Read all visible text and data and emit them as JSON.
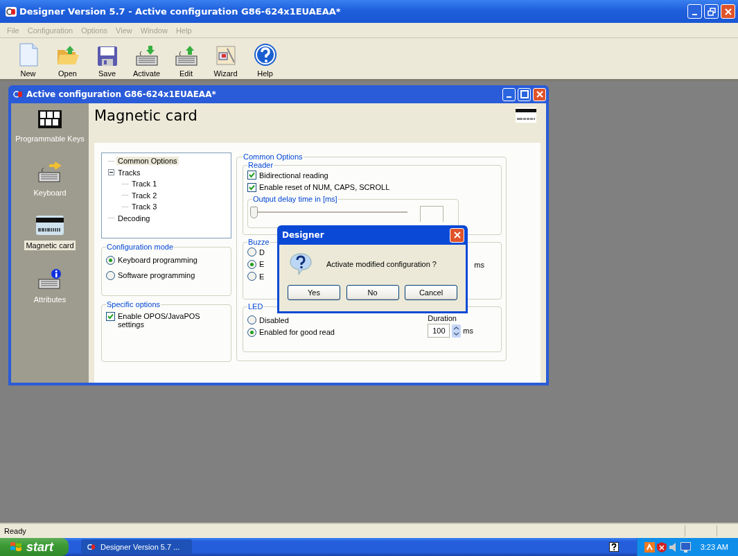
{
  "app_window": {
    "title": "Designer Version 5.7 - Active configuration G86-624x1EUAEAA*"
  },
  "menu": [
    {
      "label": "File",
      "disabled": true
    },
    {
      "label": "Configuration",
      "disabled": true
    },
    {
      "label": "Options",
      "disabled": true
    },
    {
      "label": "View",
      "disabled": true
    },
    {
      "label": "Window",
      "disabled": true
    },
    {
      "label": "Help",
      "disabled": true
    }
  ],
  "toolbar": [
    {
      "label": "New",
      "kind": "new"
    },
    {
      "label": "Open",
      "kind": "open"
    },
    {
      "label": "Save",
      "kind": "save"
    },
    {
      "label": "Activate",
      "kind": "activate"
    },
    {
      "label": "Edit",
      "kind": "edit"
    },
    {
      "label": "Wizard",
      "kind": "wizard"
    },
    {
      "label": "Help",
      "kind": "help"
    }
  ],
  "child_window": {
    "title": "Active configuration G86-624x1EUAEAA*"
  },
  "sidebar": [
    {
      "label": "Programmable Keys",
      "kind": "keys",
      "selected": false
    },
    {
      "label": "Keyboard",
      "kind": "keyboard",
      "selected": false
    },
    {
      "label": "Magnetic card",
      "kind": "card",
      "selected": true
    },
    {
      "label": "Attributes",
      "kind": "attributes",
      "selected": false
    }
  ],
  "page_title": "Magnetic card",
  "tree": [
    {
      "label": "Common Options",
      "selected": true
    },
    {
      "label": "Tracks",
      "selected": false,
      "expanded": true,
      "children": [
        {
          "label": "Track 1",
          "selected": false
        },
        {
          "label": "Track 2",
          "selected": false
        },
        {
          "label": "Track 3",
          "selected": false
        }
      ]
    },
    {
      "label": "Decoding",
      "selected": false
    }
  ],
  "configuration_mode": {
    "title": "Configuration mode",
    "options": [
      {
        "label": "Keyboard programming",
        "selected": true
      },
      {
        "label": "Software programming",
        "selected": false
      }
    ]
  },
  "specific_options": {
    "title": "Specific options",
    "options": [
      {
        "label": "Enable OPOS/JavaPOS settings",
        "checked": true
      }
    ]
  },
  "common_options": {
    "title": "Common Options",
    "reader": {
      "title": "Reader",
      "options": [
        {
          "label": "Bidirectional reading",
          "checked": true
        },
        {
          "label": "Enable reset of NUM, CAPS, SCROLL",
          "checked": true
        }
      ],
      "output_delay": {
        "title": "Output delay time in [ms]",
        "level": 0
      }
    },
    "buzzer": {
      "title": "Buzze",
      "options": [
        {
          "label": "D",
          "selected": false
        },
        {
          "label": "E",
          "selected": true
        },
        {
          "label": "E",
          "selected": false
        }
      ],
      "unit": "ms"
    },
    "led": {
      "title": "LED",
      "options": [
        {
          "label": "Disabled",
          "selected": false
        },
        {
          "label": "Enabled for good read",
          "selected": true
        }
      ],
      "duration_label": "Duration",
      "duration": "100",
      "unit": "ms"
    }
  },
  "dialog": {
    "title": "Designer",
    "message": "Activate modified configuration ?",
    "buttons": [
      "Yes",
      "No",
      "Cancel"
    ]
  },
  "status_bar": {
    "text": "Ready"
  },
  "taskbar": {
    "start": "start",
    "tasks": [
      {
        "label": "Designer Version 5.7 ..."
      }
    ],
    "clock": "3:23 AM"
  }
}
